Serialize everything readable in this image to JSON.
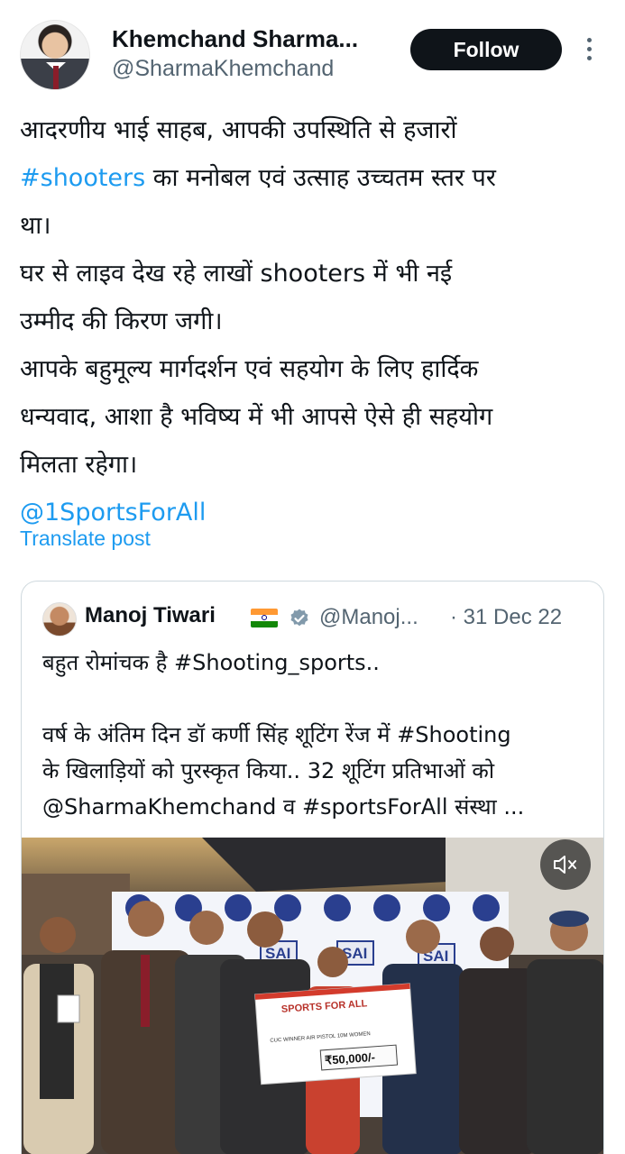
{
  "tweet": {
    "author_name": "Khemchand Sharma...",
    "author_handle": "@SharmaKhemchand",
    "follow_label": "Follow",
    "hashtag_shooters": "#shooters",
    "lines": {
      "l1": "आदरणीय भाई साहब, आपकी उपस्थिति से हजारों",
      "l2_rest": " का मनोबल एवं उत्साह उच्चतम स्तर पर",
      "l3": "था।",
      "l4": "घर से लाइव देख रहे लाखों shooters में भी नई",
      "l5": "उम्मीद की किरण जगी।",
      "l6": "आपके बहुमूल्य मार्गदर्शन एवं सहयोग के लिए हार्दिक",
      "l7": "धन्यवाद, आशा है भविष्य में भी आपसे ऐसे ही सहयोग",
      "l8": "मिलता रहेगा।"
    },
    "mention": "@1SportsForAll",
    "translate_label": "Translate post"
  },
  "quote": {
    "author_name": "Manoj Tiwari",
    "author_handle": "@Manoj...",
    "date": "· 31 Dec 22",
    "line1": "बहुत रोमांचक है #Shooting_sports..",
    "line2": "वर्ष के अंतिम दिन डॉ कर्णी सिंह शूटिंग रेंज में #Shooting",
    "line3": "के खिलाड़ियों को पुरस्कृत किया.. 32 शूटिंग प्रतिभाओं को",
    "line4": "@SharmaKhemchand व #sportsForAll संस्था ...",
    "media": {
      "banner_brand": "SAI",
      "cheque_title": "SPORTS FOR ALL",
      "cheque_line": "CUC WINNER AIR PISTOL 10M WOMEN",
      "cheque_amount": "₹50,000/-"
    }
  },
  "colors": {
    "accent": "#1d9bf0",
    "text": "#0f1419",
    "secondary": "#536471",
    "border": "#cfd9de"
  },
  "icons": [
    "more-vertical-icon",
    "india-flag-icon",
    "verified-badge-icon",
    "mute-icon"
  ]
}
